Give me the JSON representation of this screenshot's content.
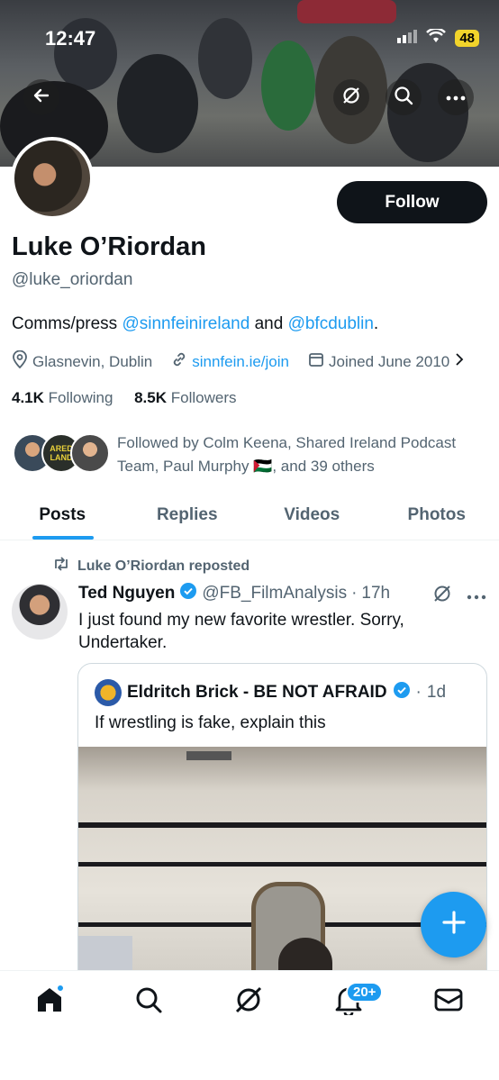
{
  "status_bar": {
    "time": "12:47",
    "battery": "48"
  },
  "profile": {
    "follow_label": "Follow",
    "name": "Luke O’Riordan",
    "handle": "@luke_oriordan",
    "bio_prefix": "Comms/press ",
    "bio_link1": "@sinnfeinireland",
    "bio_mid": " and ",
    "bio_link2": "@bfcdublin",
    "bio_suffix": ".",
    "location": "Glasnevin, Dublin",
    "website": "sinnfein.ie/join",
    "joined": "Joined June 2010",
    "following_count": "4.1K",
    "following_label": " Following",
    "followers_count": "8.5K",
    "followers_label": " Followers",
    "followed_by": "Followed by Colm Keena, Shared Ireland Podcast Team, Paul Murphy 🇵🇸, and 39 others",
    "followed_by_avatar_text": "ARED LAND"
  },
  "tabs": [
    {
      "label": "Posts",
      "active": true
    },
    {
      "label": "Replies"
    },
    {
      "label": "Videos"
    },
    {
      "label": "Photos"
    }
  ],
  "tweet": {
    "repost_label": "Luke O’Riordan reposted",
    "author_name": "Ted Nguyen",
    "author_handle": "@FB_FilmAnalysis",
    "separator": "·",
    "time": "17h",
    "text": "I just found my new favorite wrestler. Sorry, Undertaker.",
    "quote": {
      "author_name": "Eldritch Brick - BE NOT AFRAID",
      "separator": "·",
      "time": "1d",
      "text": "If wrestling is fake, explain this"
    }
  },
  "bottom_nav": {
    "notifications_badge": "20+"
  },
  "colors": {
    "accent": "#1d9bf0",
    "text": "#0f1419",
    "secondary": "#536471"
  }
}
